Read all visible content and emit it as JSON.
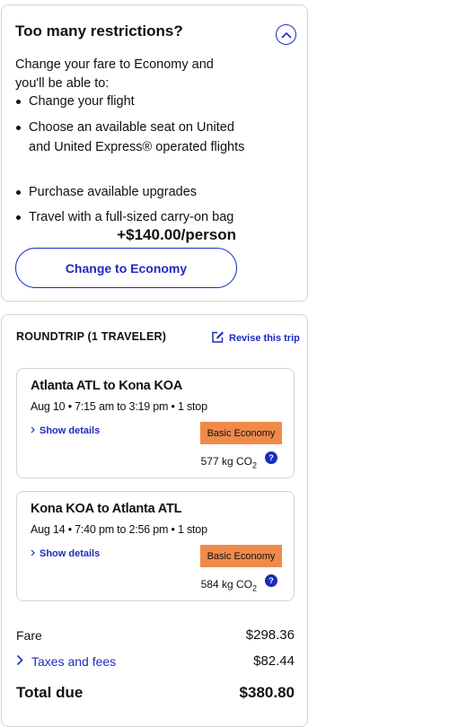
{
  "restrictions": {
    "title": "Too many restrictions?",
    "intro": "Change your fare to Economy and you'll be able to:",
    "benefits": [
      "Change your flight",
      "Choose an available seat on United and United Express® operated flights",
      "Purchase available upgrades",
      "Travel with a full-sized carry-on bag"
    ],
    "price": "+$140.00/person",
    "button_label": "Change to Economy",
    "collapse_icon": "chevron-up-icon"
  },
  "trip": {
    "heading": "ROUNDTRIP (1 TRAVELER)",
    "revise_label": "Revise this trip",
    "revise_icon": "edit-icon",
    "segments": [
      {
        "route": "Atlanta ATL to Kona KOA",
        "time": "Aug 10 • 7:15 am to 3:19 pm • 1 stop",
        "details_label": "Show details",
        "fare_class": "Basic Economy",
        "co2_value": "577 kg CO",
        "co2_sub": "2"
      },
      {
        "route": "Kona KOA to Atlanta ATL",
        "time": "Aug 14 • 7:40 pm to 2:56 pm • 1 stop",
        "details_label": "Show details",
        "fare_class": "Basic Economy",
        "co2_value": "584 kg CO",
        "co2_sub": "2"
      }
    ]
  },
  "summary": {
    "fare_label": "Fare",
    "fare_value": "$298.36",
    "taxes_label": "Taxes and fees",
    "taxes_value": "$82.44",
    "total_label": "Total due",
    "total_value": "$380.80"
  },
  "colors": {
    "brand_blue": "#1c2bbd",
    "badge_orange": "#f08a4b",
    "border": "#d4d4d4"
  }
}
